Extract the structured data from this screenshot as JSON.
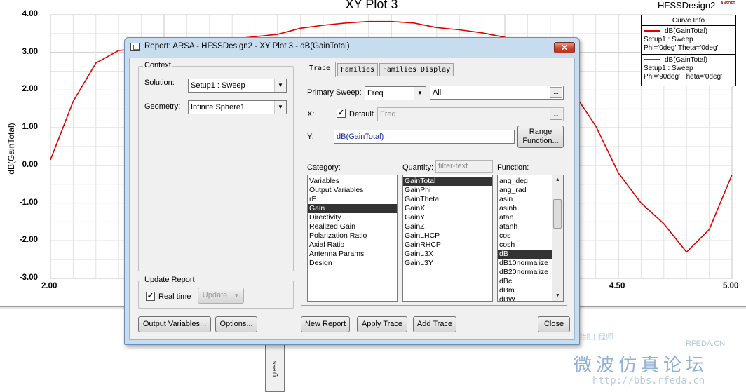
{
  "plot": {
    "title": "XY Plot 3",
    "design_name": "HFSSDesign2",
    "logo_text": "ANSOFT",
    "ylabel": "dB(GainTotal)",
    "yticks": [
      "4.00",
      "3.00",
      "2.00",
      "1.00",
      "0.00",
      "-1.00",
      "-2.00",
      "-3.00"
    ],
    "xticks": [
      "2.00",
      "4.50",
      "5.00"
    ],
    "legend": {
      "title": "Curve Info",
      "entries": [
        {
          "name": "dB(GainTotal)",
          "setup": "Setup1 : Sweep",
          "vars": "Phi='0deg' Theta='0deg'",
          "color": "#e00000"
        },
        {
          "name": "dB(GainTotal)",
          "setup": "Setup1 : Sweep",
          "vars": "Phi='90deg' Theta='0deg'",
          "color": "#8b2f3a"
        }
      ]
    },
    "progress_label": "gress"
  },
  "chart_data": {
    "type": "line",
    "xlim": [
      2.0,
      5.0
    ],
    "ylim": [
      -3.0,
      4.0
    ],
    "ylabel": "dB(GainTotal)",
    "grid": true,
    "series": [
      {
        "name": "dB(GainTotal)",
        "color": "#e00000",
        "x": [
          2.0,
          2.1,
          2.2,
          2.3,
          2.4,
          3.0,
          3.1,
          3.2,
          3.3,
          3.4,
          3.5,
          3.6,
          3.7,
          3.8,
          3.9,
          4.0,
          4.1,
          4.2,
          4.3,
          4.4,
          4.5,
          4.6,
          4.7,
          4.8,
          4.9,
          5.0
        ],
        "y": [
          0.15,
          1.7,
          2.72,
          3.05,
          3.1,
          3.48,
          3.64,
          3.72,
          3.78,
          3.82,
          3.82,
          3.78,
          3.66,
          3.6,
          3.52,
          3.4,
          3.1,
          2.6,
          1.95,
          1.05,
          -0.2,
          -1.0,
          -1.55,
          -2.3,
          -1.7,
          -0.25
        ]
      }
    ]
  },
  "dialog": {
    "title": "Report: ARSA - HFSSDesign2 - XY Plot 3 - dB(GainTotal)",
    "close_symbol": "✕",
    "context": {
      "label": "Context",
      "solution_label": "Solution:",
      "solution_value": "Setup1 : Sweep",
      "geometry_label": "Geometry:",
      "geometry_value": "Infinite Sphere1"
    },
    "update_report": {
      "label": "Update Report",
      "realtime_label": "Real time",
      "realtime_checked": true,
      "update_button": "Update"
    },
    "tabs": [
      "Trace",
      "Families",
      "Families Display"
    ],
    "trace": {
      "primary_sweep_label": "Primary Sweep:",
      "primary_sweep_value": "Freq",
      "primary_sweep_range": "All",
      "x_label": "X:",
      "default_label": "Default",
      "default_checked": true,
      "x_value": "Freq",
      "y_label": "Y:",
      "y_value": "dB(GainTotal)",
      "range_function_button": "Range\nFunction...",
      "category_label": "Category:",
      "quantity_label": "Quantity:",
      "quantity_filter_placeholder": "filter-text",
      "function_label": "Function:",
      "categories": [
        "Variables",
        "Output Variables",
        "rE",
        "Gain",
        "Directivity",
        "Realized Gain",
        "Polarization Ratio",
        "Axial Ratio",
        "Antenna Params",
        "Design"
      ],
      "selected_category": "Gain",
      "quantities": [
        "GainTotal",
        "GainPhi",
        "GainTheta",
        "GainX",
        "GainY",
        "GainZ",
        "GainLHCP",
        "GainRHCP",
        "GainL3X",
        "GainL3Y"
      ],
      "selected_quantity": "GainTotal",
      "functions": [
        "ang_deg",
        "ang_rad",
        "asin",
        "asinh",
        "atan",
        "atanh",
        "cos",
        "cosh",
        "dB",
        "dB10normalize",
        "dB20normalize",
        "dBc",
        "dBm",
        "dBW"
      ],
      "selected_function": "dB"
    },
    "buttons": {
      "output_variables": "Output Variables...",
      "options": "Options...",
      "new_report": "New Report",
      "apply_trace": "Apply Trace",
      "add_trace": "Add Trace",
      "close": "Close"
    }
  },
  "watermark": {
    "cn": "微波仿真论坛",
    "url": "http://bbs.rfeda.cn",
    "site": "RFEDA.CN",
    "small": "射频工程师"
  }
}
